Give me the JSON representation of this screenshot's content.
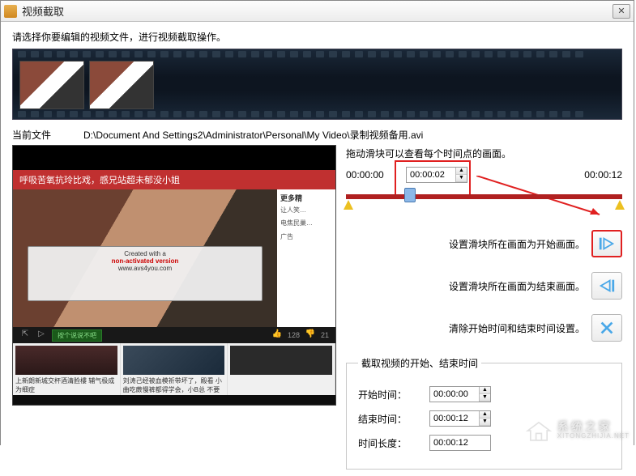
{
  "window": {
    "title": "视频截取"
  },
  "instruction": "请选择你要编辑的视频文件，进行视频截取操作。",
  "current_file": {
    "label": "当前文件",
    "path": "D:\\Document And Settings2\\Administrator\\Personal\\My Video\\录制视频备用.avi"
  },
  "slider": {
    "hint": "拖动滑块可以查看每个时间点的画面。",
    "start_time": "00:00:00",
    "pos_time": "00:00:02",
    "end_time": "00:00:12"
  },
  "actions": {
    "set_start": "设置滑块所在画面为开始画面。",
    "set_end": "设置滑块所在画面为结束画面。",
    "clear": "清除开始时间和结束时间设置。"
  },
  "range": {
    "legend": "截取视频的开始、结束时间",
    "start_label": "开始时间：",
    "start_value": "00:00:00",
    "end_label": "结束时间：",
    "end_value": "00:00:12",
    "length_label": "时间长度：",
    "length_value": "00:00:12"
  },
  "preview": {
    "topbar": "呼吸苦氧抗玲比戏，感兄站超未郁没小姐",
    "side_title": "更多精",
    "side_items": [
      "让人笑…",
      "电焦民巢…",
      "广告"
    ],
    "overlay_line1": "Created with a",
    "overlay_line2": "non-activated version",
    "overlay_line3": "www.avs4you.com",
    "bottombar_green": "按个说说不吧",
    "likes": "128",
    "dislikes": "21",
    "bcell1": "上新朗新城交杯酒清脸樓\n辅气极成为细症",
    "bcell2": "刘涛己经被血模祈带坏了，殿看\n小曲吃蕨慢裤都得学会，小B总\n不要"
  },
  "watermark": {
    "cn": "系统之家",
    "en": "XITONGZHIJIA.NET"
  }
}
